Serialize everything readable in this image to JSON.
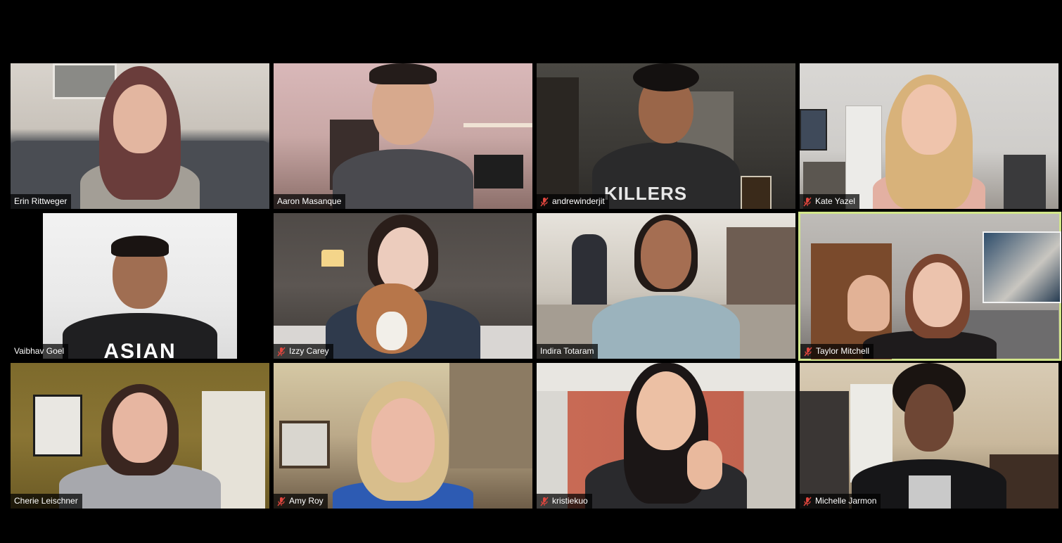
{
  "participants": [
    {
      "name": "Erin Rittweger",
      "muted": false,
      "active": false
    },
    {
      "name": "Aaron Masanque",
      "muted": false,
      "active": false
    },
    {
      "name": "andrewinderjit",
      "muted": true,
      "active": false
    },
    {
      "name": "Kate Yazel",
      "muted": true,
      "active": false
    },
    {
      "name": "Vaibhav Goel",
      "muted": false,
      "active": false
    },
    {
      "name": "Izzy Carey",
      "muted": true,
      "active": false
    },
    {
      "name": "Indira Totaram",
      "muted": false,
      "active": false
    },
    {
      "name": "Taylor Mitchell",
      "muted": true,
      "active": true
    },
    {
      "name": "Cherie Leischner",
      "muted": false,
      "active": false
    },
    {
      "name": "Amy Roy",
      "muted": true,
      "active": false
    },
    {
      "name": "kristiekuo",
      "muted": true,
      "active": false
    },
    {
      "name": "Michelle Jarmon",
      "muted": true,
      "active": false
    }
  ],
  "shirt_text": {
    "andrewinderjit": "KILLERS",
    "vaibhav": "ASIAN"
  },
  "colors": {
    "active_border": "#d2e68a",
    "mute_icon": "#e0463e",
    "background": "#000000"
  },
  "icons": {
    "muted": "microphone-muted-icon"
  }
}
